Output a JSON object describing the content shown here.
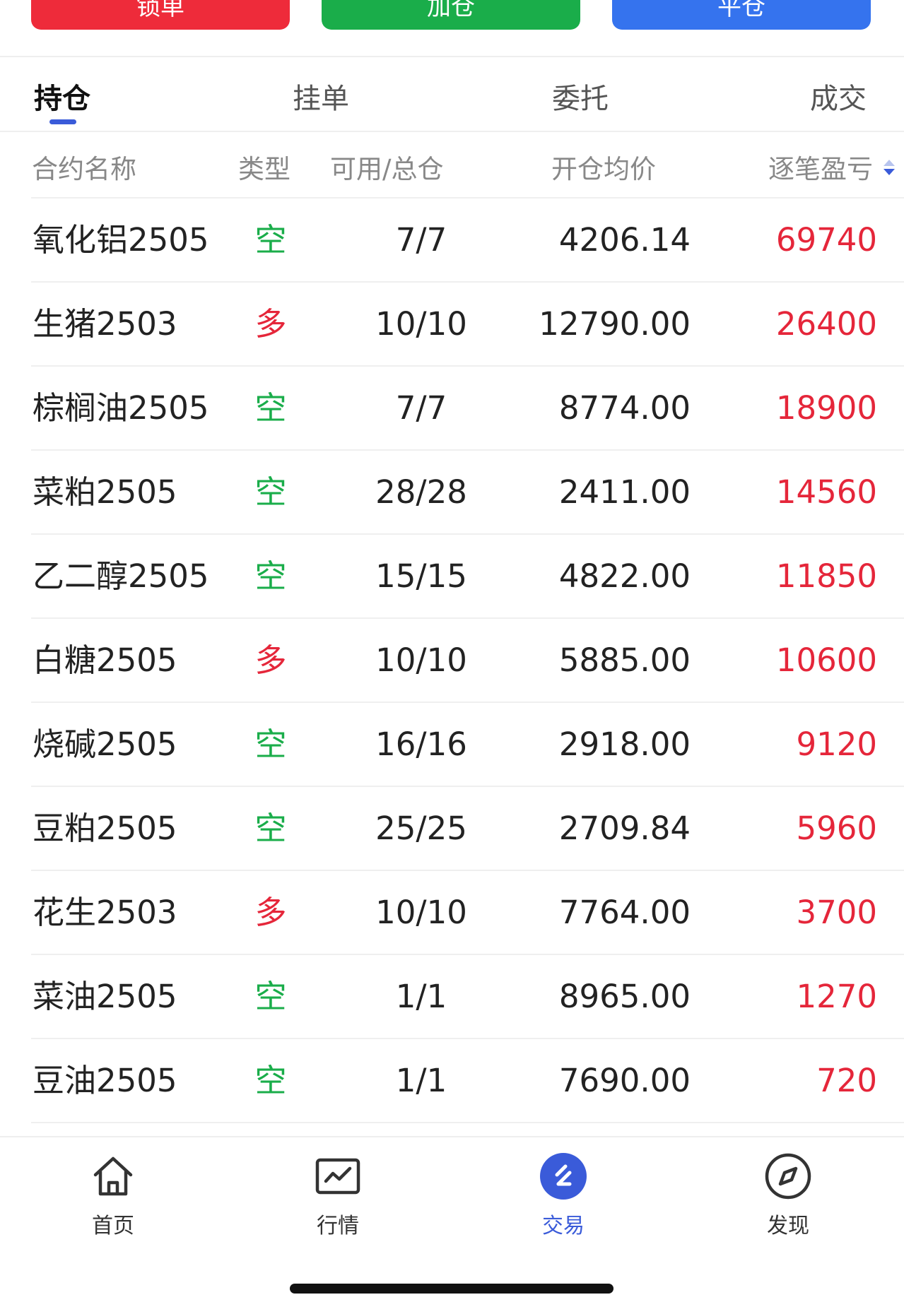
{
  "actions": {
    "lock_label": "锁单",
    "add_label": "加仓",
    "close_label": "平仓"
  },
  "tabs": [
    {
      "label": "持仓",
      "active": true
    },
    {
      "label": "挂单",
      "active": false
    },
    {
      "label": "委托",
      "active": false
    },
    {
      "label": "成交",
      "active": false
    }
  ],
  "columns": {
    "name": "合约名称",
    "type": "类型",
    "position": "可用/总仓",
    "avg_price": "开仓均价",
    "pnl": "逐笔盈亏"
  },
  "rows": [
    {
      "name": "氧化铝2505",
      "type": "空",
      "position": "7/7",
      "avg_price": "4206.14",
      "pnl": "69740"
    },
    {
      "name": "生猪2503",
      "type": "多",
      "position": "10/10",
      "avg_price": "12790.00",
      "pnl": "26400"
    },
    {
      "name": "棕榈油2505",
      "type": "空",
      "position": "7/7",
      "avg_price": "8774.00",
      "pnl": "18900"
    },
    {
      "name": "菜粕2505",
      "type": "空",
      "position": "28/28",
      "avg_price": "2411.00",
      "pnl": "14560"
    },
    {
      "name": "乙二醇2505",
      "type": "空",
      "position": "15/15",
      "avg_price": "4822.00",
      "pnl": "11850"
    },
    {
      "name": "白糖2505",
      "type": "多",
      "position": "10/10",
      "avg_price": "5885.00",
      "pnl": "10600"
    },
    {
      "name": "烧碱2505",
      "type": "空",
      "position": "16/16",
      "avg_price": "2918.00",
      "pnl": "9120"
    },
    {
      "name": "豆粕2505",
      "type": "空",
      "position": "25/25",
      "avg_price": "2709.84",
      "pnl": "5960"
    },
    {
      "name": "花生2503",
      "type": "多",
      "position": "10/10",
      "avg_price": "7764.00",
      "pnl": "3700"
    },
    {
      "name": "菜油2505",
      "type": "空",
      "position": "1/1",
      "avg_price": "8965.00",
      "pnl": "1270"
    },
    {
      "name": "豆油2505",
      "type": "空",
      "position": "1/1",
      "avg_price": "7690.00",
      "pnl": "720"
    }
  ],
  "nav": [
    {
      "label": "首页",
      "icon": "home-icon",
      "active": false
    },
    {
      "label": "行情",
      "icon": "chart-icon",
      "active": false
    },
    {
      "label": "交易",
      "icon": "trade-icon",
      "active": true
    },
    {
      "label": "发现",
      "icon": "compass-icon",
      "active": false
    }
  ],
  "colors": {
    "short": "#1aad4a",
    "long": "#e5263a",
    "profit": "#e5263a",
    "accent": "#3a5bd9",
    "lock_button": "#ee2b3a",
    "add_button": "#1aad4a",
    "close_button": "#3573ee"
  }
}
